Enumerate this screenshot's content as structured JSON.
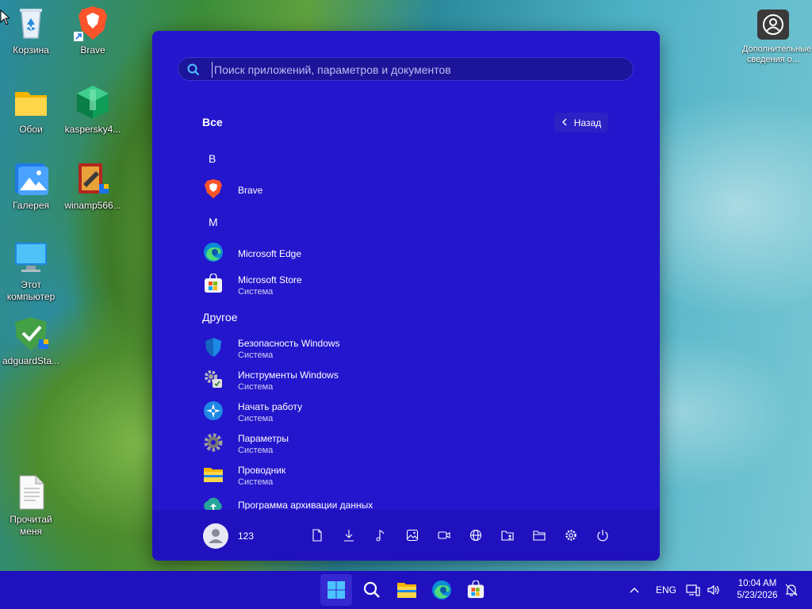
{
  "desktop": {
    "icons": [
      {
        "label": "Корзина"
      },
      {
        "label": "Brave"
      },
      {
        "label": "Обои"
      },
      {
        "label": "kaspersky4..."
      },
      {
        "label": "Галерея"
      },
      {
        "label": "winamp566..."
      },
      {
        "label": "Этот компьютер"
      },
      {
        "label": "adguardSta..."
      },
      {
        "label": "Прочитай меня"
      }
    ],
    "top_right_tile": {
      "label": "Дополнительные сведения о..."
    }
  },
  "start_menu": {
    "search": {
      "placeholder": "Поиск приложений, параметров и документов"
    },
    "section_title": "Все",
    "back_label": "Назад",
    "letters": [
      "B",
      "M"
    ],
    "group_other": "Другое",
    "apps": [
      {
        "name": "Brave",
        "sub": ""
      },
      {
        "name": "Microsoft Edge",
        "sub": ""
      },
      {
        "name": "Microsoft Store",
        "sub": "Система"
      },
      {
        "name": "Безопасность Windows",
        "sub": "Система"
      },
      {
        "name": "Инструменты Windows",
        "sub": "Система"
      },
      {
        "name": "Начать работу",
        "sub": "Система"
      },
      {
        "name": "Параметры",
        "sub": "Система"
      },
      {
        "name": "Проводник",
        "sub": "Система"
      },
      {
        "name": "Программа архивации данных",
        "sub": ""
      }
    ],
    "footer": {
      "user_name": "123"
    }
  },
  "taskbar": {
    "language": "ENG",
    "time": "10:04 AM",
    "date": "5/23/2026"
  },
  "colors": {
    "menu_bg": "#2316cc",
    "taskbar_bg": "#1f12be",
    "accent": "#3528d0"
  }
}
